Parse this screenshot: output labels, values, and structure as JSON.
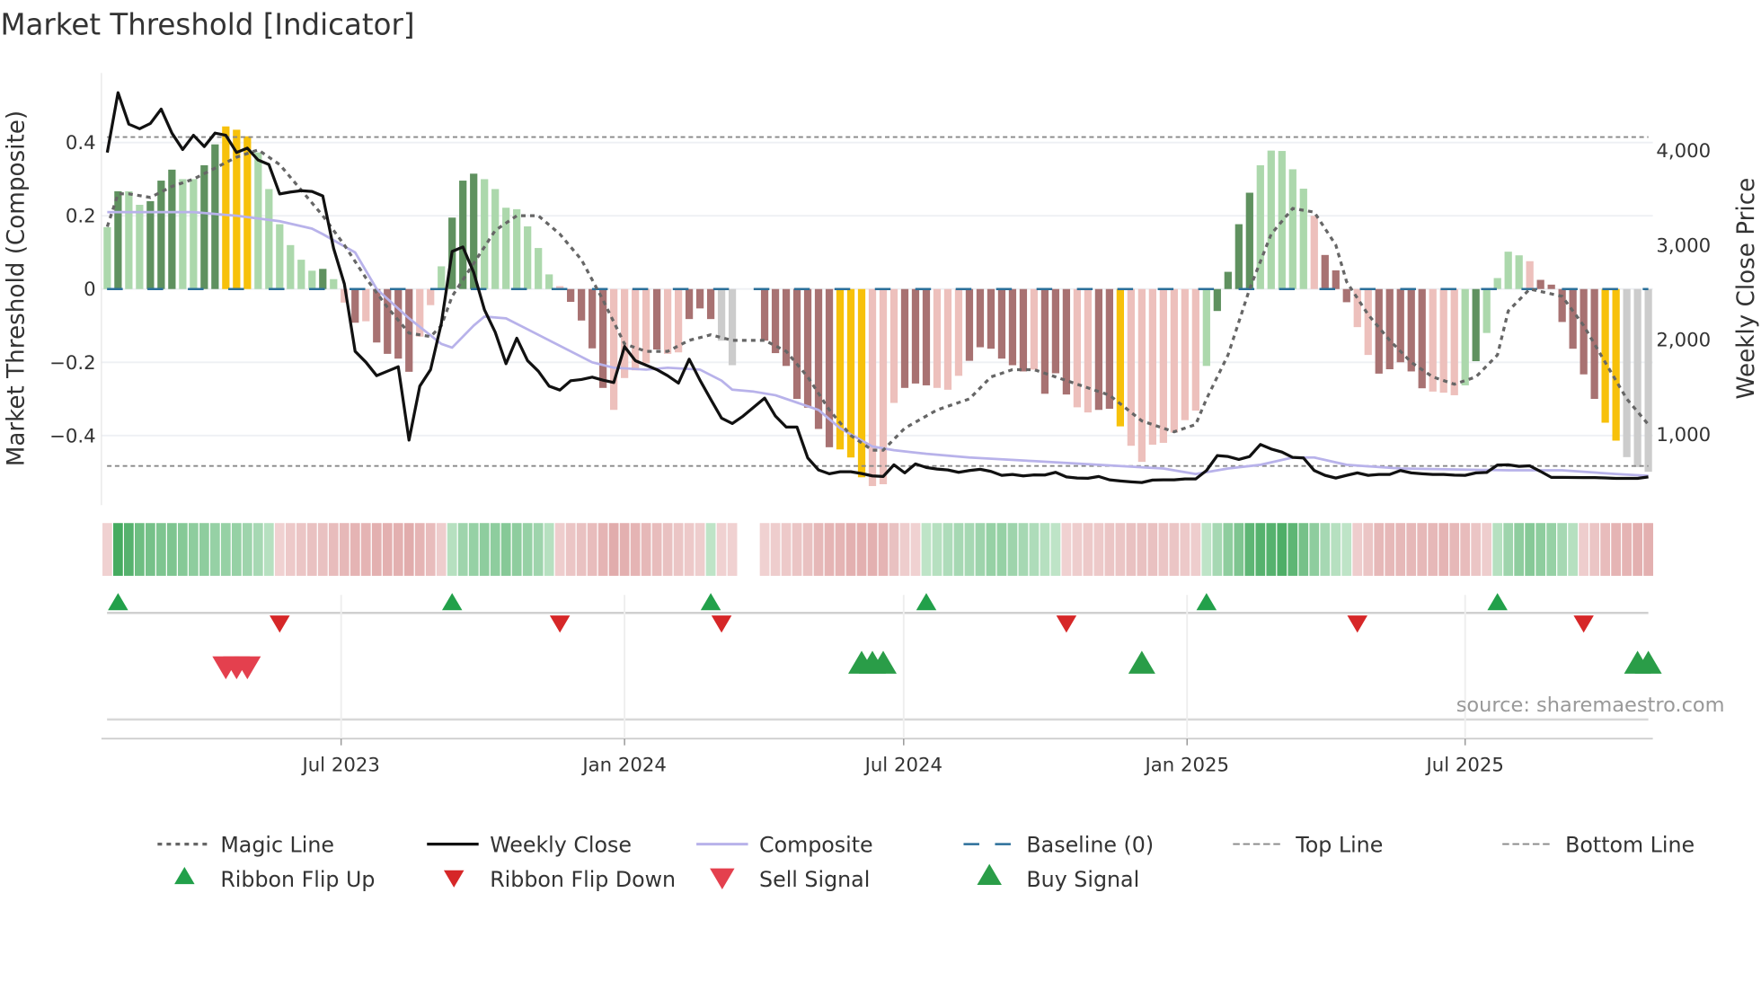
{
  "chart_data": {
    "type": "bar",
    "title": "Market Threshold [Indicator]",
    "ylabel": "Market Threshold (Composite)",
    "ylabel_right": "Weekly Close Price",
    "ylim": [
      -0.59,
      0.59
    ],
    "ylim_right": [
      253,
      4818
    ],
    "xlim": [
      -0.5,
      143.5
    ],
    "x_unit": "week index",
    "left_ticks": [
      {
        "v": 0.4,
        "label": "0.4"
      },
      {
        "v": 0.2,
        "label": "0.2"
      },
      {
        "v": 0,
        "label": "0"
      },
      {
        "v": -0.2,
        "label": "−0.2"
      },
      {
        "v": -0.4,
        "label": "−0.4"
      }
    ],
    "right_ticks": [
      {
        "v": 4000,
        "label": "4,000"
      },
      {
        "v": 3000,
        "label": "3,000"
      },
      {
        "v": 2000,
        "label": "2,000"
      },
      {
        "v": 1000,
        "label": "1,000"
      }
    ],
    "x_ticks": [
      {
        "v": 21.7,
        "label": "Jul 2023"
      },
      {
        "v": 48.0,
        "label": "Jan 2024"
      },
      {
        "v": 73.9,
        "label": "Jul 2024"
      },
      {
        "v": 100.2,
        "label": "Jan 2025"
      },
      {
        "v": 126.0,
        "label": "Jul 2025"
      }
    ],
    "top_line": 0.415,
    "bottom_line": -0.483,
    "baseline": 0,
    "bar_colors": {
      "G": "#5f915f",
      "g": "#acd8ac",
      "Y": "#f7c10a",
      "R": "#a87272",
      "r": "#edc0bc"
    },
    "bars": [
      0.169,
      0.267,
      0.267,
      0.23,
      0.24,
      0.296,
      0.326,
      0.3,
      0.3,
      0.338,
      0.395,
      0.444,
      0.435,
      0.417,
      0.373,
      0.273,
      0.177,
      0.12,
      0.08,
      0.05,
      0.055,
      0.027,
      -0.037,
      -0.092,
      -0.088,
      -0.146,
      -0.177,
      -0.19,
      -0.226,
      -0.13,
      -0.044,
      0.062,
      0.195,
      0.296,
      0.315,
      0.3,
      0.273,
      0.222,
      0.218,
      0.171,
      0.112,
      0.04,
      0.008,
      -0.035,
      -0.086,
      -0.162,
      -0.27,
      -0.33,
      -0.243,
      -0.222,
      -0.203,
      -0.165,
      -0.177,
      -0.173,
      -0.082,
      -0.053,
      -0.082,
      -0.141,
      -0.208,
      null,
      null,
      -0.141,
      -0.175,
      -0.21,
      -0.3,
      -0.324,
      -0.382,
      -0.432,
      -0.438,
      -0.46,
      -0.514,
      -0.538,
      -0.533,
      -0.311,
      -0.27,
      -0.258,
      -0.263,
      -0.27,
      -0.275,
      -0.237,
      -0.196,
      -0.159,
      -0.163,
      -0.19,
      -0.208,
      -0.225,
      -0.22,
      -0.286,
      -0.23,
      -0.288,
      -0.323,
      -0.337,
      -0.33,
      -0.327,
      -0.375,
      -0.428,
      -0.472,
      -0.425,
      -0.42,
      -0.392,
      -0.358,
      -0.332,
      -0.21,
      -0.06,
      0.047,
      0.177,
      0.263,
      0.338,
      0.378,
      0.377,
      0.327,
      0.274,
      0.2,
      0.093,
      0.051,
      -0.036,
      -0.104,
      -0.18,
      -0.231,
      -0.219,
      -0.2,
      -0.225,
      -0.271,
      -0.28,
      -0.283,
      -0.29,
      -0.263,
      -0.197,
      -0.12,
      0.03,
      0.102,
      0.092,
      0.076,
      0.025,
      0.012,
      -0.09,
      -0.163,
      -0.233,
      -0.3,
      -0.365,
      -0.414,
      -0.459,
      -0.486,
      -0.499
    ],
    "bar_class": "gGggGGGggGGYYYggggggGgrRrRRRRrrgGGGgggggggrRRRRrrrrRrrRRRxxrRRRRRRRRYYYrrrRRRrrrRRRRRRrRRRrrRRYrrrrrrrgGGGGgggggrRRRrrRRRRRrrrgGggggrRRRRRRYY",
    "weekly_close": [
      3977,
      4609,
      4277,
      4229,
      4285,
      4436,
      4182,
      4009,
      4160,
      4040,
      4182,
      4160,
      3977,
      4024,
      3898,
      3850,
      3540,
      3560,
      3574,
      3566,
      3519,
      2966,
      2590,
      1878,
      1763,
      1620,
      1668,
      1715,
      940,
      1510,
      1684,
      2174,
      2933,
      2980,
      2711,
      2316,
      2079,
      1747,
      2016,
      1779,
      1668,
      1510,
      1468,
      1567,
      1580,
      1605,
      1573,
      1548,
      1927,
      1779,
      1731,
      1684,
      1620,
      1542,
      1795,
      1573,
      1370,
      1172,
      1115,
      1193,
      1288,
      1383,
      1193,
      1077,
      1077,
      751,
      624,
      584,
      605,
      605,
      586,
      561,
      555,
      679,
      593,
      688,
      650,
      634,
      624,
      599,
      618,
      631,
      609,
      567,
      577,
      561,
      572,
      571,
      599,
      551,
      539,
      536,
      555,
      520,
      508,
      498,
      491,
      517,
      520,
      520,
      529,
      529,
      618,
      776,
      766,
      735,
      766,
      893,
      846,
      814,
      757,
      751,
      618,
      567,
      539,
      567,
      593,
      567,
      577,
      577,
      618,
      593,
      584,
      577,
      577,
      570,
      567,
      593,
      598,
      676,
      679,
      662,
      668,
      609,
      546,
      546,
      545,
      544,
      543,
      540,
      535,
      535,
      535,
      551
    ],
    "composite": [
      [
        0,
        0.21
      ],
      [
        8,
        0.21
      ],
      [
        12,
        0.2
      ],
      [
        16,
        0.185
      ],
      [
        19,
        0.165
      ],
      [
        20,
        0.15
      ],
      [
        23,
        0.1
      ],
      [
        25,
        0.0
      ],
      [
        28,
        -0.08
      ],
      [
        31,
        -0.15
      ],
      [
        32,
        -0.16
      ],
      [
        34,
        -0.1
      ],
      [
        35,
        -0.075
      ],
      [
        37,
        -0.08
      ],
      [
        39,
        -0.11
      ],
      [
        41,
        -0.14
      ],
      [
        43,
        -0.17
      ],
      [
        45,
        -0.2
      ],
      [
        47,
        -0.215
      ],
      [
        50,
        -0.22
      ],
      [
        52,
        -0.215
      ],
      [
        55,
        -0.22
      ],
      [
        57,
        -0.25
      ],
      [
        58,
        -0.275
      ],
      [
        60,
        -0.28
      ],
      [
        62,
        -0.29
      ],
      [
        66,
        -0.33
      ],
      [
        68,
        -0.38
      ],
      [
        71,
        -0.43
      ],
      [
        73,
        -0.44
      ],
      [
        76,
        -0.45
      ],
      [
        80,
        -0.46
      ],
      [
        86,
        -0.47
      ],
      [
        92,
        -0.48
      ],
      [
        98,
        -0.49
      ],
      [
        101,
        -0.505
      ],
      [
        104,
        -0.49
      ],
      [
        107,
        -0.48
      ],
      [
        110,
        -0.46
      ],
      [
        112,
        -0.46
      ],
      [
        115,
        -0.48
      ],
      [
        120,
        -0.49
      ],
      [
        130,
        -0.495
      ],
      [
        135,
        -0.495
      ],
      [
        140,
        -0.505
      ],
      [
        143,
        -0.51
      ]
    ],
    "magic_line": [
      [
        0,
        0.17
      ],
      [
        1,
        0.26
      ],
      [
        2,
        0.26
      ],
      [
        4,
        0.25
      ],
      [
        6,
        0.28
      ],
      [
        8,
        0.3
      ],
      [
        10,
        0.33
      ],
      [
        12,
        0.36
      ],
      [
        14,
        0.38
      ],
      [
        16,
        0.34
      ],
      [
        18,
        0.27
      ],
      [
        20,
        0.2
      ],
      [
        22,
        0.12
      ],
      [
        24,
        0.03
      ],
      [
        26,
        -0.05
      ],
      [
        28,
        -0.12
      ],
      [
        30,
        -0.13
      ],
      [
        31,
        -0.1
      ],
      [
        32,
        -0.02
      ],
      [
        34,
        0.07
      ],
      [
        36,
        0.16
      ],
      [
        38,
        0.2
      ],
      [
        40,
        0.2
      ],
      [
        42,
        0.15
      ],
      [
        44,
        0.08
      ],
      [
        46,
        -0.03
      ],
      [
        48,
        -0.15
      ],
      [
        50,
        -0.17
      ],
      [
        52,
        -0.17
      ],
      [
        54,
        -0.14
      ],
      [
        56,
        -0.125
      ],
      [
        58,
        -0.14
      ],
      [
        61,
        -0.14
      ],
      [
        63,
        -0.17
      ],
      [
        65,
        -0.24
      ],
      [
        67,
        -0.33
      ],
      [
        69,
        -0.4
      ],
      [
        71,
        -0.44
      ],
      [
        72,
        -0.44
      ],
      [
        74,
        -0.38
      ],
      [
        77,
        -0.33
      ],
      [
        80,
        -0.3
      ],
      [
        82,
        -0.24
      ],
      [
        84,
        -0.22
      ],
      [
        86,
        -0.22
      ],
      [
        88,
        -0.24
      ],
      [
        90,
        -0.26
      ],
      [
        93,
        -0.29
      ],
      [
        96,
        -0.36
      ],
      [
        98,
        -0.38
      ],
      [
        99,
        -0.39
      ],
      [
        101,
        -0.37
      ],
      [
        102,
        -0.3
      ],
      [
        104,
        -0.18
      ],
      [
        106,
        0.0
      ],
      [
        108,
        0.15
      ],
      [
        110,
        0.22
      ],
      [
        112,
        0.21
      ],
      [
        114,
        0.12
      ],
      [
        115,
        0.02
      ],
      [
        117,
        -0.07
      ],
      [
        119,
        -0.14
      ],
      [
        121,
        -0.2
      ],
      [
        123,
        -0.24
      ],
      [
        125,
        -0.26
      ],
      [
        127,
        -0.24
      ],
      [
        129,
        -0.18
      ],
      [
        130,
        -0.06
      ],
      [
        132,
        0.0
      ],
      [
        135,
        -0.02
      ],
      [
        137,
        -0.1
      ],
      [
        139,
        -0.2
      ],
      [
        141,
        -0.3
      ],
      [
        143,
        -0.37
      ]
    ],
    "ribbon": [
      -0.15,
      0.9,
      0.8,
      0.65,
      0.6,
      0.55,
      0.55,
      0.5,
      0.45,
      0.45,
      0.4,
      0.4,
      0.4,
      0.35,
      0.3,
      0.2,
      -0.15,
      -0.25,
      -0.3,
      -0.35,
      -0.35,
      -0.4,
      -0.45,
      -0.5,
      -0.5,
      -0.55,
      -0.55,
      -0.55,
      -0.6,
      -0.5,
      -0.4,
      -0.2,
      0.2,
      0.35,
      0.4,
      0.45,
      0.45,
      0.5,
      0.45,
      0.4,
      0.35,
      0.2,
      -0.2,
      -0.3,
      -0.35,
      -0.4,
      -0.5,
      -0.6,
      -0.55,
      -0.5,
      -0.45,
      -0.4,
      -0.35,
      -0.3,
      -0.25,
      -0.2,
      0.15,
      -0.15,
      -0.15,
      null,
      null,
      -0.15,
      -0.2,
      -0.25,
      -0.3,
      -0.35,
      -0.45,
      -0.5,
      -0.5,
      -0.55,
      -0.55,
      -0.55,
      -0.5,
      -0.35,
      -0.2,
      -0.15,
      0.15,
      0.2,
      0.25,
      0.3,
      0.3,
      0.35,
      0.4,
      0.4,
      0.35,
      0.3,
      0.25,
      0.2,
      0.15,
      -0.15,
      -0.2,
      -0.25,
      -0.25,
      -0.3,
      -0.3,
      -0.35,
      -0.35,
      -0.35,
      -0.3,
      -0.3,
      -0.25,
      -0.2,
      0.15,
      0.3,
      0.45,
      0.55,
      0.75,
      0.8,
      0.8,
      0.85,
      0.75,
      0.6,
      0.45,
      0.3,
      0.2,
      0.15,
      -0.2,
      -0.3,
      -0.45,
      -0.45,
      -0.45,
      -0.45,
      -0.45,
      -0.45,
      -0.5,
      -0.45,
      -0.4,
      -0.3,
      -0.2,
      0.2,
      0.35,
      0.45,
      0.5,
      0.45,
      0.4,
      0.3,
      0.2,
      -0.2,
      -0.3,
      -0.4,
      -0.5,
      -0.5,
      -0.55,
      -0.55
    ],
    "ribbon_flip_up": [
      1,
      32,
      56,
      76,
      102,
      129
    ],
    "ribbon_flip_down": [
      16,
      42,
      57,
      89,
      116,
      137
    ],
    "sell_signals": [
      11,
      12,
      13
    ],
    "buy_signals": [
      70,
      71,
      72,
      96,
      142,
      143
    ],
    "colors": {
      "weekly_close": "#111111",
      "composite": "#b8b2ea",
      "magic": "#666666",
      "baseline": "#2b6f99",
      "top_bottom": "#888888",
      "flip_up": "#22a04a",
      "flip_down": "#d62728",
      "sell": "#e4404e",
      "buy": "#2a9d48"
    },
    "legend": [
      {
        "key": "magic",
        "label": "Magic Line"
      },
      {
        "key": "close",
        "label": "Weekly Close"
      },
      {
        "key": "composite",
        "label": "Composite"
      },
      {
        "key": "baseline",
        "label": "Baseline (0)"
      },
      {
        "key": "top",
        "label": "Top Line"
      },
      {
        "key": "bottom",
        "label": "Bottom Line"
      },
      {
        "key": "flip_up",
        "label": "Ribbon Flip Up"
      },
      {
        "key": "flip_down",
        "label": "Ribbon Flip Down"
      },
      {
        "key": "sell",
        "label": "Sell Signal"
      },
      {
        "key": "buy",
        "label": "Buy Signal"
      }
    ],
    "legend_placement": "bottom"
  },
  "source": "source: sharemaestro.com"
}
